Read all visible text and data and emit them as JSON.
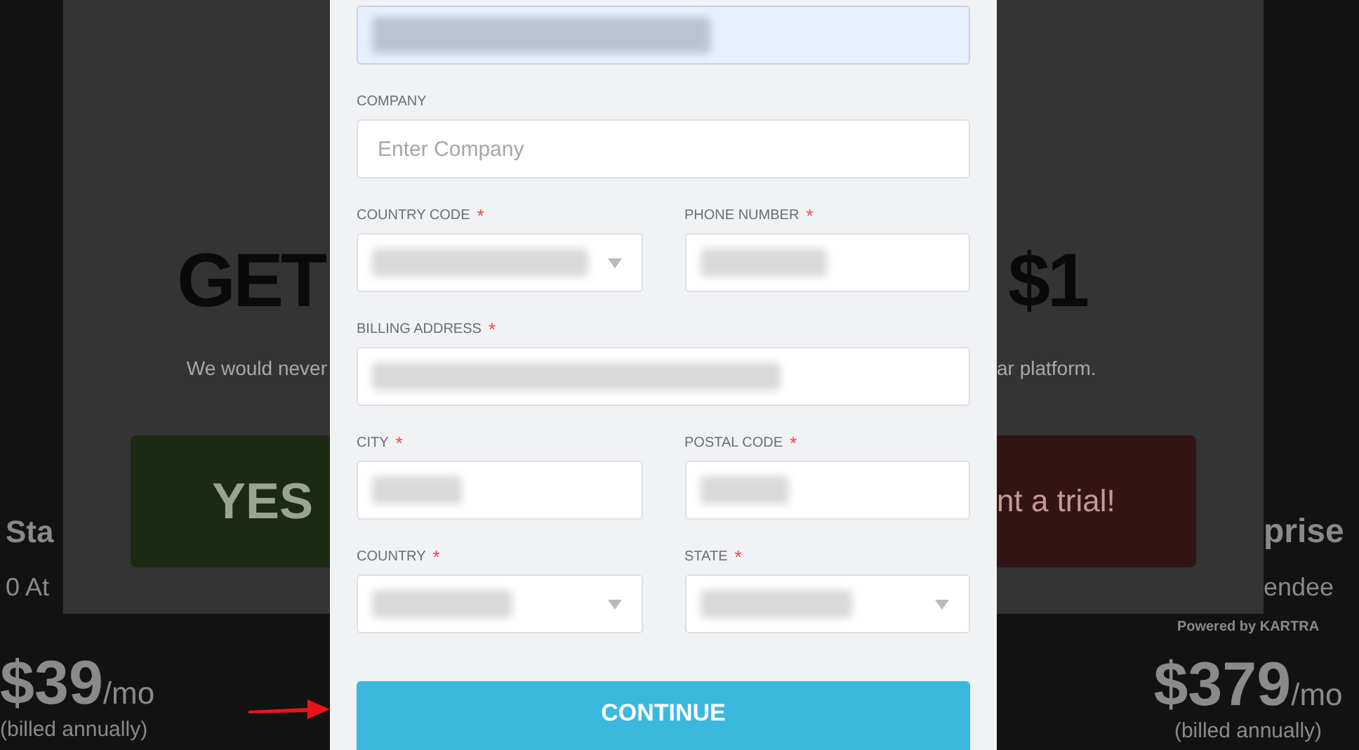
{
  "backdrop": {
    "plans": [
      {
        "name": "Sta",
        "attendees": "0 At",
        "price": "$39",
        "period": "/mo",
        "billing": "(billed annually)"
      },
      {
        "name": "prise",
        "attendees": "endee",
        "price": "$379",
        "period": "/mo",
        "billing": "(billed annually)"
      }
    ]
  },
  "offer_dialog": {
    "headline_left": "GET",
    "headline_right": "$1",
    "text_left": "We would never",
    "text_right": "ar platform.",
    "accept_button": "YES",
    "decline_button": "nt a trial!",
    "footer": "Powered by KARTRA"
  },
  "form": {
    "autofill_field": {
      "redacted": true,
      "autofilled": true
    },
    "rows": [
      [
        {
          "label": "COMPANY",
          "kind": "input",
          "placeholder": "Enter Company"
        }
      ],
      [
        {
          "label": "COUNTRY CODE",
          "required_mark": "*",
          "kind": "select",
          "redacted": true
        },
        {
          "label": "PHONE NUMBER",
          "required_mark": "*",
          "kind": "input",
          "redacted": true
        }
      ],
      [
        {
          "label": "BILLING ADDRESS",
          "required_mark": "*",
          "kind": "input",
          "redacted": true
        }
      ],
      [
        {
          "label": "CITY",
          "required_mark": "*",
          "kind": "input",
          "redacted": true
        },
        {
          "label": "POSTAL CODE",
          "required_mark": "*",
          "kind": "input",
          "redacted": true
        }
      ],
      [
        {
          "label": "COUNTRY",
          "required_mark": "*",
          "kind": "select",
          "redacted": true
        },
        {
          "label": "STATE",
          "required_mark": "*",
          "kind": "select",
          "redacted": true
        }
      ]
    ],
    "submit_button": "CONTINUE"
  }
}
